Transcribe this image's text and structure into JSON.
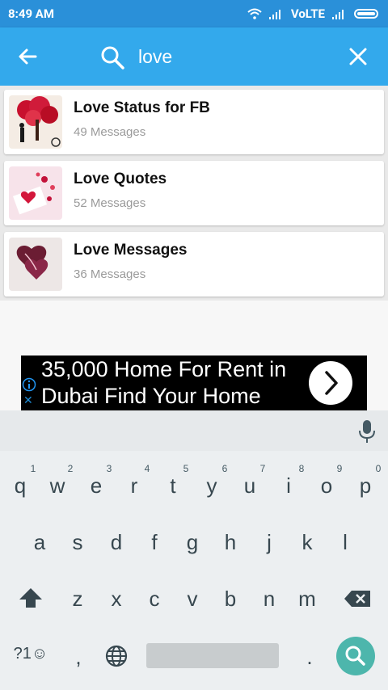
{
  "status_bar": {
    "time": "8:49 AM",
    "network": "VoLTE"
  },
  "search": {
    "query": "love",
    "back_icon": "arrow-left-icon",
    "search_icon": "search-icon",
    "clear_icon": "close-icon"
  },
  "results": [
    {
      "title": "Love Status for FB",
      "subtitle": "49 Messages",
      "thumb": "couple-tree-image"
    },
    {
      "title": "Love Quotes",
      "subtitle": "52 Messages",
      "thumb": "envelope-hearts-image"
    },
    {
      "title": "Love Messages",
      "subtitle": "36 Messages",
      "thumb": "hearts-image"
    }
  ],
  "ad": {
    "line1": "35,000 Home For Rent in",
    "line2": "Dubai Find Your Home"
  },
  "keyboard": {
    "row1": [
      "q",
      "w",
      "e",
      "r",
      "t",
      "y",
      "u",
      "i",
      "o",
      "p"
    ],
    "row1_hints": [
      "1",
      "2",
      "3",
      "4",
      "5",
      "6",
      "7",
      "8",
      "9",
      "0"
    ],
    "row2": [
      "a",
      "s",
      "d",
      "f",
      "g",
      "h",
      "j",
      "k",
      "l"
    ],
    "row3": [
      "z",
      "x",
      "c",
      "v",
      "b",
      "n",
      "m"
    ],
    "symbols_label": "?1☺",
    "comma": ",",
    "period": "."
  },
  "colors": {
    "status_bar": "#2a90d9",
    "app_bar": "#33a9ec",
    "enter_key": "#4db6ac"
  }
}
